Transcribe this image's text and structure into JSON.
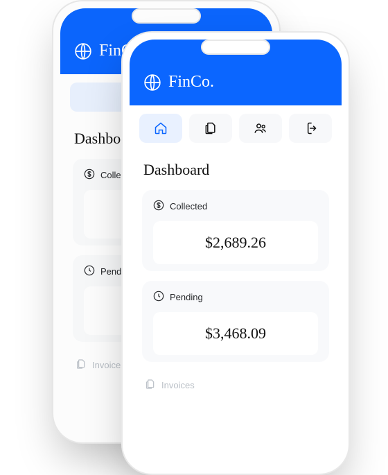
{
  "brand": "FinCo.",
  "nav": {
    "home": "home-icon",
    "docs": "documents-icon",
    "users": "users-icon",
    "logout": "logout-icon"
  },
  "page_title": "Dashboard",
  "cards": {
    "collected": {
      "label": "Collected",
      "amount": "$2,689.26"
    },
    "pending": {
      "label": "Pending",
      "amount": "$3,468.09"
    }
  },
  "invoices_label": "Invoices"
}
